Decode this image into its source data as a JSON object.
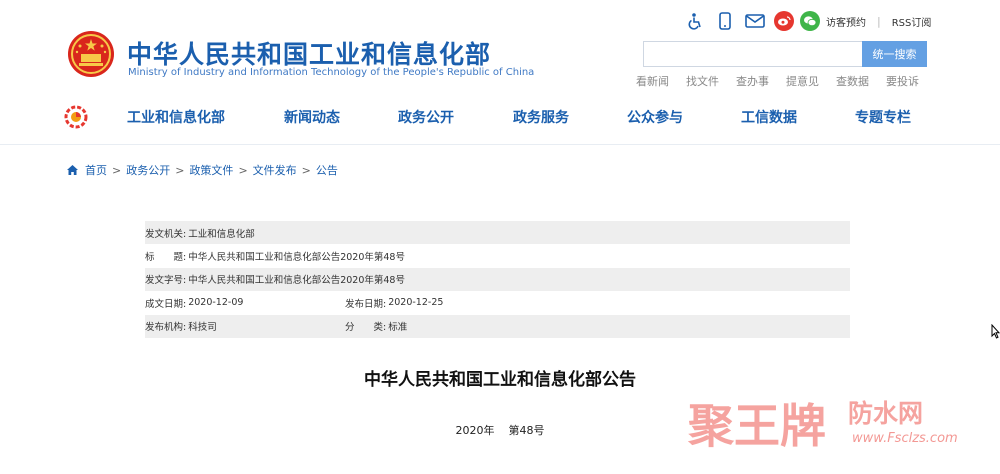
{
  "header": {
    "title_cn": "中华人民共和国工业和信息化部",
    "title_en": "Ministry of Industry and Information Technology of the People's Republic of China",
    "utility": {
      "icons": [
        "accessibility-icon",
        "mobile-icon",
        "mail-icon",
        "weibo-icon",
        "wechat-icon"
      ],
      "visit_label": "访客预约",
      "separator": "|",
      "rss_label": "RSS订阅"
    },
    "search": {
      "placeholder": "",
      "button_label": "统一搜索"
    },
    "quick_links": [
      "看新闻",
      "找文件",
      "查办事",
      "提意见",
      "查数据",
      "要投诉"
    ]
  },
  "nav": {
    "items": [
      "工业和信息化部",
      "新闻动态",
      "政务公开",
      "政务服务",
      "公众参与",
      "工信数据",
      "专题专栏"
    ]
  },
  "breadcrumb": {
    "items": [
      "首页",
      "政务公开",
      "政策文件",
      "文件发布",
      "公告"
    ],
    "separator": ">"
  },
  "doc_info": {
    "issuer_label": "发文机关:",
    "issuer": "工业和信息化部",
    "title_label": "标　　题:",
    "title": "中华人民共和国工业和信息化部公告2020年第48号",
    "doc_no_label": "发文字号:",
    "doc_no": "中华人民共和国工业和信息化部公告2020年第48号",
    "created_label": "成文日期:",
    "created": "2020-12-09",
    "published_label": "发布日期:",
    "published": "2020-12-25",
    "org_label": "发布机构:",
    "org": "科技司",
    "category_label": "分　　类:",
    "category": "标准"
  },
  "document": {
    "title": "中华人民共和国工业和信息化部公告",
    "number": "2020年    第48号"
  },
  "watermark": {
    "brand": "聚王牌",
    "site_name": "防水网",
    "url": "www.Fsclzs.com"
  },
  "colors": {
    "brand_blue": "#1b5fae",
    "search_button": "#64a0e3",
    "row_shade": "#eeeeee",
    "watermark_red": "#e8322a"
  }
}
